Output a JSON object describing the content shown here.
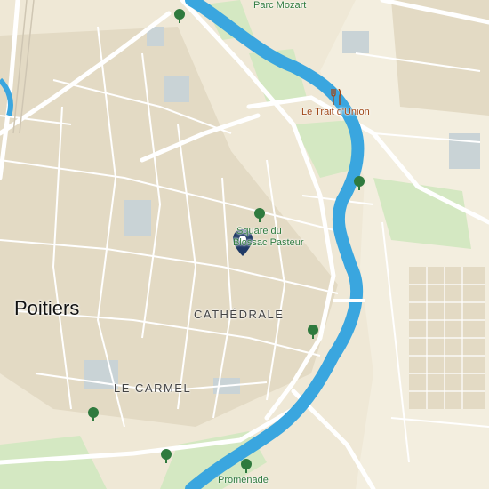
{
  "map": {
    "city_label": "Poitiers",
    "districts": [
      {
        "name": "cathedrale",
        "label": "CATHÉDRALE"
      },
      {
        "name": "le-carmel",
        "label": "LE CARMEL"
      }
    ],
    "pois": [
      {
        "label": "Parc Mozart",
        "icon": "tree-icon"
      },
      {
        "label": "Square du Blossac Pasteur",
        "line1": "Square du",
        "line2": "Blossac Pasteur",
        "icon": "tree-icon"
      },
      {
        "label": "Le Trait d'Union",
        "icon": "restaurant-icon"
      },
      {
        "label": "Promenade",
        "icon": "tree-icon"
      }
    ],
    "selected_marker": "location-pin-icon",
    "colors": {
      "land": "#efe8d6",
      "blocks": "#e3dac4",
      "park": "#d4e8c2",
      "water": "#3aa6df",
      "roads": "#ffffff",
      "poi_text": "#2f7a3e",
      "food_text": "#a04818",
      "pin": "#1f3a66"
    }
  }
}
